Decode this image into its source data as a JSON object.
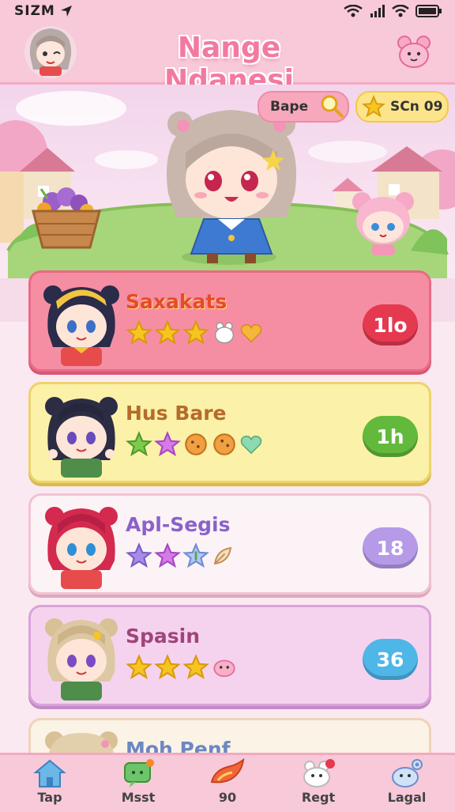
{
  "status": {
    "time": "SIZM"
  },
  "header": {
    "title": "Nange Ndanesi"
  },
  "topbar": {
    "search_label": "Bape",
    "score_label": "SCn 09"
  },
  "cards": [
    {
      "name": "Saxakats",
      "badge": "1lo",
      "badge_color": "#e53950"
    },
    {
      "name": "Hus Bare",
      "badge": "1h",
      "badge_color": "#63b93b"
    },
    {
      "name": "Apl-Segis",
      "badge": "18",
      "badge_color": "#b69ae8"
    },
    {
      "name": "Spasin",
      "badge": "36",
      "badge_color": "#4fb6e8"
    },
    {
      "name": "Moh Penf",
      "badge": "",
      "badge_color": "#f2c1c9"
    }
  ],
  "nav": [
    {
      "label": "Tap",
      "icon": "home-icon"
    },
    {
      "label": "Msst",
      "icon": "chat-icon"
    },
    {
      "label": "90",
      "icon": "flame-icon"
    },
    {
      "label": "Regt",
      "icon": "pet-icon"
    },
    {
      "label": "Lagal",
      "icon": "settings-icon"
    }
  ],
  "colors": {
    "header_bg": "#f8c9d8",
    "title": "#f27aa0",
    "accent": "#e53950"
  }
}
